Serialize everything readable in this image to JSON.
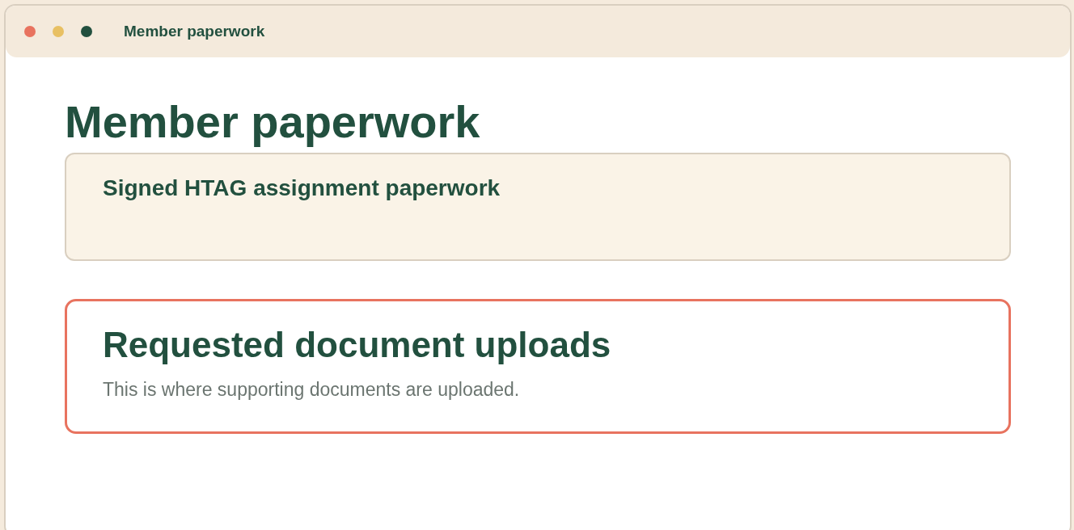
{
  "window": {
    "title": "Member paperwork",
    "controls": [
      {
        "color": "#e8735f"
      },
      {
        "color": "#e8c063"
      },
      {
        "color": "#22503f"
      }
    ]
  },
  "heading": "Member paperwork",
  "sections": [
    {
      "kind": "plain",
      "title": "Signed HTAG assignment paperwork"
    },
    {
      "kind": "highlighted",
      "title": "Requested document uploads",
      "description": "This is where supporting documents are uploaded."
    }
  ]
}
